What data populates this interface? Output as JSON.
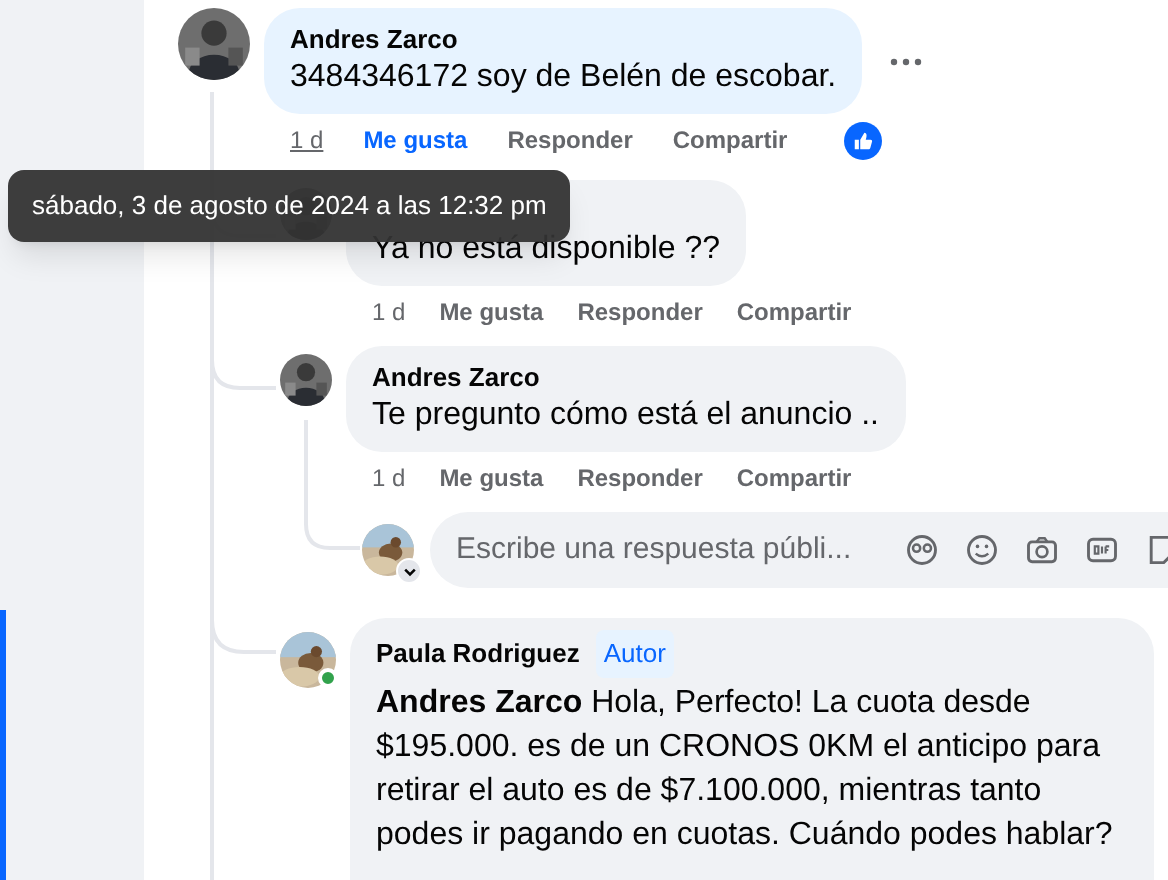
{
  "comment": {
    "author": "Andres Zarco",
    "text": "3484346172 soy de Belén de escobar.",
    "highlighted": true,
    "time": "1 d",
    "time_hovered": true,
    "liked": true,
    "like_label": "Me gusta",
    "reply_label": "Responder",
    "share_label": "Compartir",
    "replies": [
      {
        "text": "Ya no está disponible ??",
        "time": "1 d",
        "liked": false,
        "like_label": "Me gusta",
        "reply_label": "Responder",
        "share_label": "Compartir"
      },
      {
        "author": "Andres Zarco",
        "text": "Te pregunto cómo está el anuncio ..",
        "time": "1 d",
        "liked": false,
        "like_label": "Me gusta",
        "reply_label": "Responder",
        "share_label": "Compartir"
      }
    ]
  },
  "tooltip": {
    "text": "sábado, 3 de agosto de 2024 a las 12:32 pm"
  },
  "reply_box": {
    "placeholder": "Escribe una respuesta públi..."
  },
  "author_reply": {
    "author": "Paula Rodriguez",
    "badge": "Autor",
    "online": true,
    "text": "**Andres Zarco** Hola, Perfecto! La cuota desde $195.000. es de un CRONOS 0KM el anticipo para retirar el auto es de $7.100.000, mientras tanto podes ir pagando en cuotas. Cuándo podes hablar?"
  }
}
